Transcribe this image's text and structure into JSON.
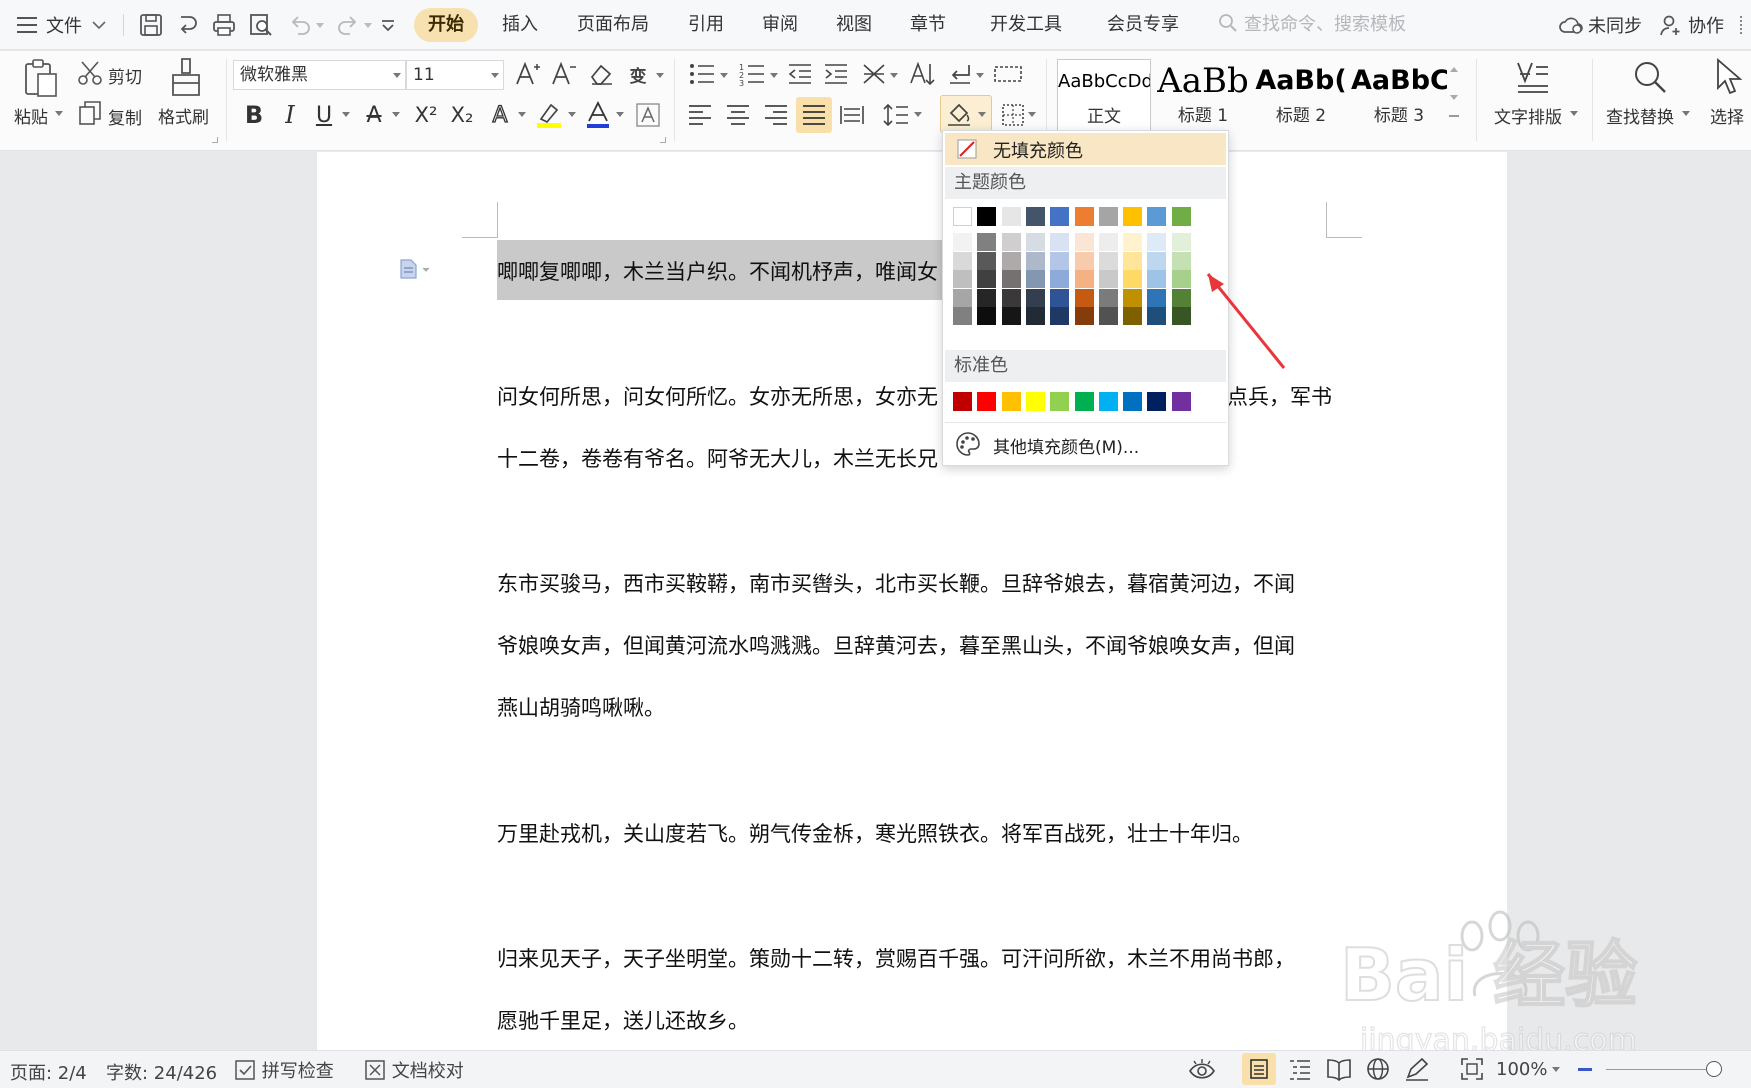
{
  "menubar": {
    "file_label": "文件",
    "tabs": [
      {
        "label": "开始",
        "active": true
      },
      {
        "label": "插入"
      },
      {
        "label": "页面布局"
      },
      {
        "label": "引用"
      },
      {
        "label": "审阅"
      },
      {
        "label": "视图"
      },
      {
        "label": "章节"
      },
      {
        "label": "开发工具"
      },
      {
        "label": "会员专享"
      }
    ],
    "search_placeholder": "查找命令、搜索模板",
    "sync_label": "未同步",
    "collab_label": "协作"
  },
  "ribbon": {
    "paste_label": "粘贴",
    "cut_label": "剪切",
    "copy_label": "复制",
    "format_painter_label": "格式刷",
    "font_name": "微软雅黑",
    "font_size": "11",
    "styles": [
      {
        "sample": "AaBbCcDd",
        "name": "正文"
      },
      {
        "sample": "AaBb",
        "name": "标题 1"
      },
      {
        "sample": "AaBb(",
        "name": "标题 2"
      },
      {
        "sample": "AaBbC",
        "name": "标题 3"
      }
    ],
    "text_layout_label": "文字排版",
    "find_replace_label": "查找替换",
    "select_label": "选择"
  },
  "document": {
    "paragraphs": [
      {
        "line1": "唧唧复唧唧，木兰当户织。不闻机杼声，唯闻女"
      },
      {
        "line1": "问女何所思，问女何所忆。女亦无所思，女亦无",
        "line1b": "点兵，军书",
        "line2": "十二卷，卷卷有爷名。阿爷无大儿，木兰无长兄"
      },
      {
        "line1": "东市买骏马，西市买鞍鞯，南市买辔头，北市买长鞭。旦辞爷娘去，暮宿黄河边，不闻",
        "line2": "爷娘唤女声，但闻黄河流水鸣溅溅。旦辞黄河去，暮至黑山头，不闻爷娘唤女声，但闻",
        "line3": "燕山胡骑鸣啾啾。"
      },
      {
        "line1": "万里赴戎机，关山度若飞。朔气传金柝，寒光照铁衣。将军百战死，壮士十年归。"
      },
      {
        "line1": "归来见天子，天子坐明堂。策勋十二转，赏赐百千强。可汗问所欲，木兰不用尚书郎，",
        "line2": "愿驰千里足，送儿还故乡。"
      }
    ]
  },
  "fill_dropdown": {
    "no_fill_label": "无填充颜色",
    "theme_header": "主题颜色",
    "standard_header": "标准色",
    "more_colors_label": "其他填充颜色(M)...",
    "theme_top": [
      "#ffffff",
      "#000000",
      "#e7e6e6",
      "#44546a",
      "#4472c4",
      "#ed7d31",
      "#a5a5a5",
      "#ffc000",
      "#5b9bd5",
      "#70ad47"
    ],
    "theme_shades": [
      [
        "#f2f2f2",
        "#d9d9d9",
        "#bfbfbf",
        "#a6a6a6",
        "#808080"
      ],
      [
        "#808080",
        "#595959",
        "#404040",
        "#262626",
        "#0d0d0d"
      ],
      [
        "#d0cece",
        "#aeaaaa",
        "#757171",
        "#3a3838",
        "#171616"
      ],
      [
        "#d6dce4",
        "#adb9ca",
        "#8497b0",
        "#333f4f",
        "#222a35"
      ],
      [
        "#d9e2f3",
        "#b4c6e7",
        "#8eaadb",
        "#2f5496",
        "#1f3864"
      ],
      [
        "#fbe5d5",
        "#f7cbac",
        "#f4b183",
        "#c55a11",
        "#843c0b"
      ],
      [
        "#ededed",
        "#dbdbdb",
        "#c9c9c9",
        "#7b7b7b",
        "#525252"
      ],
      [
        "#fff2cc",
        "#ffe599",
        "#ffd966",
        "#bf9000",
        "#7f6000"
      ],
      [
        "#deebf6",
        "#bdd7ee",
        "#9dc3e6",
        "#2e75b5",
        "#1e4e79"
      ],
      [
        "#e2efd9",
        "#c5e0b3",
        "#a8d08d",
        "#538135",
        "#375623"
      ]
    ],
    "standard": [
      "#c00000",
      "#ff0000",
      "#ffc000",
      "#ffff00",
      "#92d050",
      "#00b050",
      "#00b0f0",
      "#0070c0",
      "#002060",
      "#7030a0"
    ]
  },
  "statusbar": {
    "page": "页面: 2/4",
    "words": "字数: 24/426",
    "spell": "拼写检查",
    "proof": "文档校对",
    "zoom": "100%"
  },
  "watermark": {
    "brand": "Bai 经验",
    "url": "jingyan.baidu.com"
  }
}
